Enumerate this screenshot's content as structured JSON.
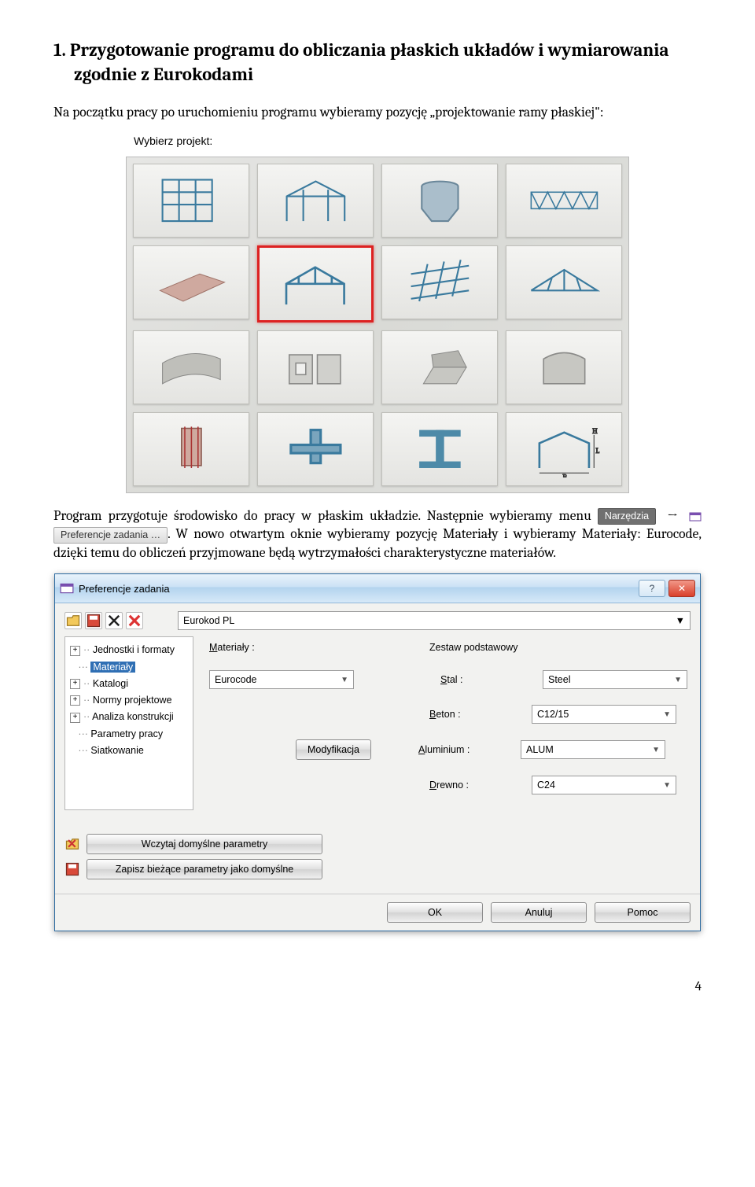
{
  "heading": "1. Przygotowanie programu do obliczania płaskich układów i wymiarowania zgodnie z Eurokodami",
  "intro": "Na początku pracy po uruchomieniu programu wybieramy pozycję „projektowanie ramy płaskiej\":",
  "figure": {
    "label": "Wybierz projekt:"
  },
  "para2_a": "Program przygotuje środowisko do pracy w płaskim układzie. Następnie wybieramy menu",
  "chip_tools": "Narzędzia",
  "arrow": "→",
  "chip_prefs": "Preferencje zadania …",
  "para2_b": ". W nowo otwartym oknie wybieramy pozycję Materiały i wybieramy Materiały: Eurocode, dzięki temu do obliczeń przyjmowane będą wytrzymałości charakterystyczne materiałów.",
  "dialog": {
    "title": "Preferencje zadania",
    "norm_set": "Eurokod PL",
    "tree": {
      "n0": "Jednostki i formaty",
      "n1": "Materiały",
      "n2": "Katalogi",
      "n3": "Normy projektowe",
      "n4": "Analiza konstrukcji",
      "n5": "Parametry pracy",
      "n6": "Siatkowanie"
    },
    "labels": {
      "materials": "Materiały :",
      "set": "Zestaw podstawowy",
      "steel": "Stal :",
      "concrete": "Beton :",
      "aluminium": "Aluminium :",
      "wood": "Drewno :",
      "modify": "Modyfikacja"
    },
    "values": {
      "materials": "Eurocode",
      "steel": "Steel",
      "concrete": "C12/15",
      "aluminium": "ALUM",
      "wood": "C24"
    },
    "foot_left": {
      "load": "Wczytaj domyślne parametry",
      "save": "Zapisz bieżące parametry jako domyślne"
    },
    "buttons": {
      "ok": "OK",
      "cancel": "Anuluj",
      "help": "Pomoc"
    }
  },
  "page_number": "4"
}
